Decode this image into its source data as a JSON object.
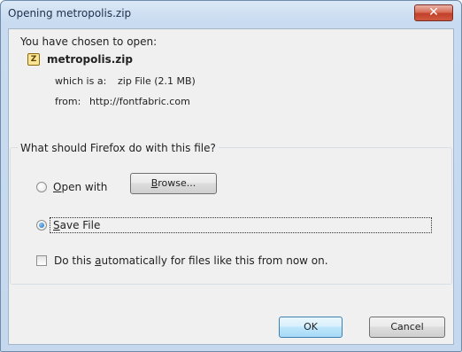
{
  "window": {
    "title": "Opening metropolis.zip",
    "close_glyph": "✕"
  },
  "prompt": {
    "chosen_text": "You have chosen to open:",
    "file_icon": "zip-file-icon",
    "file_icon_glyph": "Z",
    "filename": "metropolis.zip",
    "type_label": "which is a:",
    "type_value": "zip File (2.1 MB)",
    "from_label": "from:",
    "from_value": "http://fontfabric.com"
  },
  "action": {
    "question": "What should Firefox do with this file?",
    "open_with_access": "O",
    "open_with_rest": "pen with",
    "browse_access": "B",
    "browse_rest": "rowse...",
    "save_access": "S",
    "save_rest": "ave File",
    "selected": "save_file",
    "auto_pre": "Do this ",
    "auto_access": "a",
    "auto_post": "utomatically for files like this from now on.",
    "auto_checked": false
  },
  "buttons": {
    "ok": "OK",
    "cancel": "Cancel"
  }
}
